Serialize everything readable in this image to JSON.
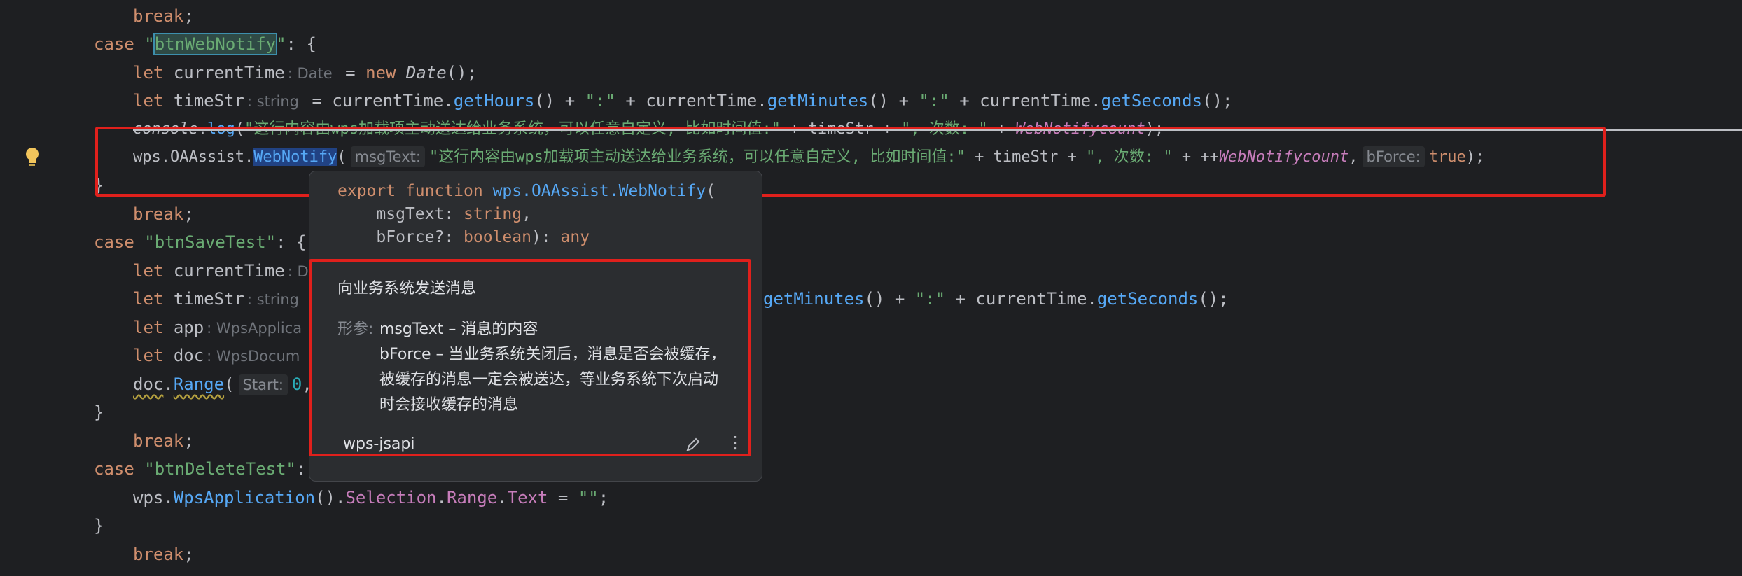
{
  "code": {
    "l1": {
      "kw": "break",
      "p": ";"
    },
    "l2": {
      "kw": "case",
      "q1": "\"",
      "s": "btnWebNotify",
      "q2": "\"",
      "p": ": {"
    },
    "l3": {
      "kw": "let",
      "v": "currentTime",
      "hint": ": Date",
      "eq": " = ",
      "new": "new",
      "cls": "Date",
      "p": "();"
    },
    "l4": {
      "kw": "let",
      "v": "timeStr",
      "hint": ": string",
      "a": " = currentTime.",
      "f1": "getHours",
      "b": "() + ",
      "s1": "\":\"",
      "c": " + currentTime.",
      "f2": "getMinutes",
      "d": "() + ",
      "s2": "\":\"",
      "e": " + currentTime.",
      "f3": "getSeconds",
      "end": "();"
    },
    "l5": {
      "a": "console",
      "b": ".",
      "f": "log",
      "c": "(",
      "s1": "\"这行内容由wps加载项主动送达给业务系统，可以任意自定义, 比如时间值:\"",
      "d": " + timeStr + ",
      "s2": "\", 次数: \"",
      "e": " + ",
      "v": "WebNotifycount",
      "end": ");"
    },
    "l6": {
      "a": "wps.OAAssist.",
      "f": "WebNotify",
      "b": "(",
      "h1": "msgText:",
      "s1": "\"这行内容由wps加载项主动送达给业务系统，可以任意自定义, 比如时间值:\"",
      "c": " + timeStr + ",
      "s2": "\", 次数: \"",
      "d": " + ++",
      "v": "WebNotifycount",
      "e": ",",
      "h2": "bForce:",
      "kw": "true",
      "end": ");"
    },
    "l7": {
      "p": "}"
    },
    "l8": {
      "kw": "break",
      "p": ";"
    },
    "l9": {
      "kw": "case",
      "s": "\"btnSaveTest\"",
      "p": ": {"
    },
    "l10": {
      "kw": "let",
      "v": "currentTime",
      "hint": ": D"
    },
    "l11": {
      "kw": "let",
      "v": "timeStr",
      "hint": ": string",
      "f2": "getMinutes",
      "d": "() + ",
      "s2": "\":\"",
      "e": " + currentTime.",
      "f3": "getSeconds",
      "end": "();"
    },
    "l12": {
      "kw": "let",
      "v": "app",
      "hint": ": WpsApplica"
    },
    "l13": {
      "kw": "let",
      "v": "doc",
      "hint": ": WpsDocum"
    },
    "l14": {
      "a": "doc",
      "b": ".",
      "f": "Range",
      "c": "(",
      "h": "Start:",
      "n": "0",
      "p": ","
    },
    "l15": {
      "p": "}"
    },
    "l16": {
      "kw": "break",
      "p": ";"
    },
    "l17": {
      "kw": "case",
      "s": "\"btnDeleteTest\"",
      "p": ":"
    },
    "l18": {
      "a": "wps.",
      "f": "WpsApplication",
      "b": "().",
      "p1": "Selection",
      "c": ".",
      "p2": "Range",
      "d": ".",
      "p3": "Text",
      "e": " = ",
      "s": "\"\"",
      "end": ";"
    },
    "l19": {
      "p": "}"
    },
    "l20": {
      "kw": "break",
      "p": ";"
    }
  },
  "popup": {
    "sig1a": "export function ",
    "sig1b": "wps.OAAssist.",
    "sig1c": "WebNotify",
    "sig1d": "(",
    "sig2a": "msgText: ",
    "sig2b": "string",
    "sig2c": ",",
    "sig3a": "bForce?: ",
    "sig3b": "boolean",
    "sig3c": "): ",
    "sig3d": "any",
    "description": "向业务系统发送消息",
    "params_label": "形参:",
    "p1_name": "msgText",
    "p1_dash": " – ",
    "p1_desc": "消息的内容",
    "p2_name": "bForce",
    "p2_dash": " – ",
    "p2_desc": "当业务系统关闭后，消息是否会被缓存，被缓存的消息一定会被送达，等业务系统下次启动时会接收缓存的消息",
    "source": "wps-jsapi",
    "more": "⋮"
  },
  "colors": {
    "highlight_box": "#e0201c",
    "keyword": "#cf8e6d",
    "string": "#6aab73",
    "function": "#56a8f5"
  },
  "icons": [
    "lightbulb-icon",
    "edit-icon",
    "more-options-icon"
  ]
}
